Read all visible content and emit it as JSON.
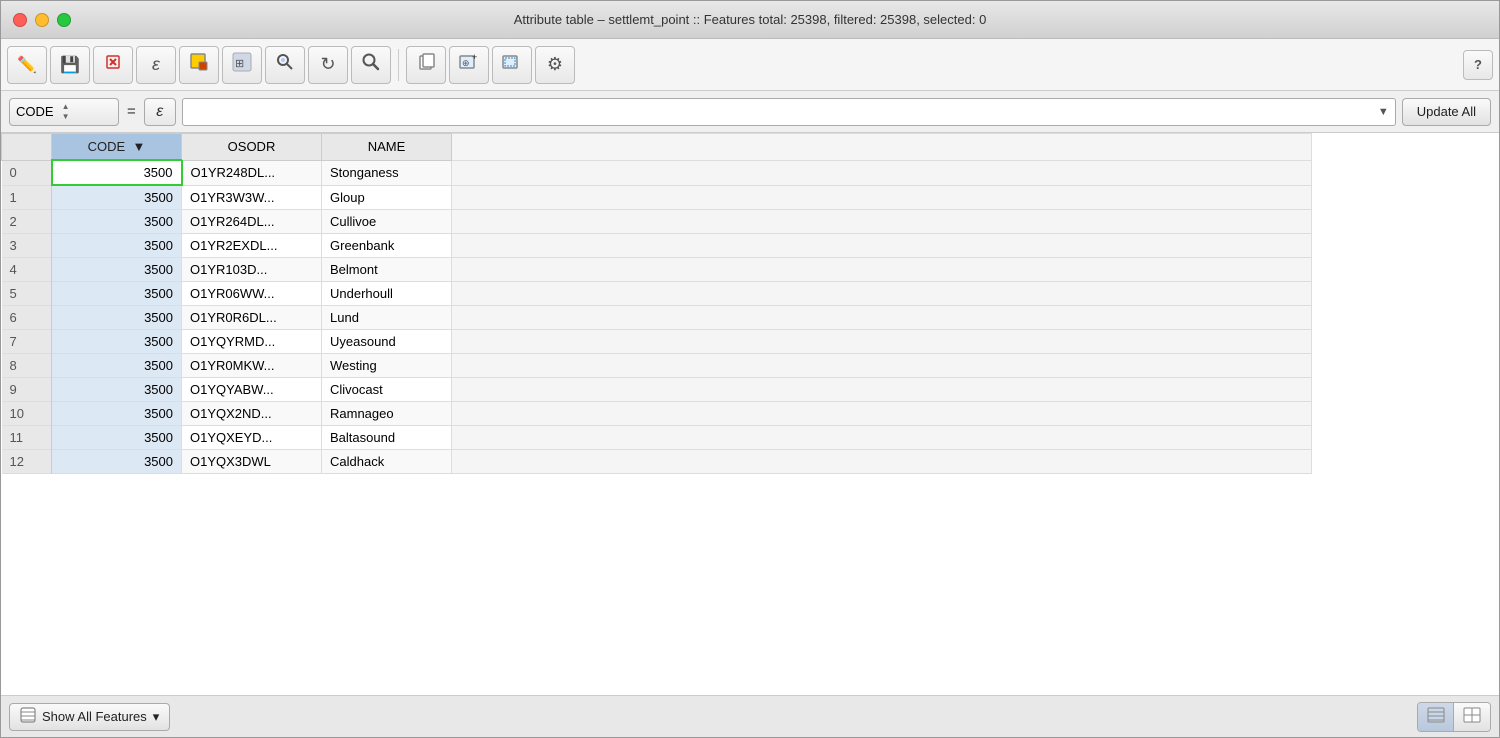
{
  "titlebar": {
    "title": "Attribute table – settlemt_point :: Features total: 25398, filtered: 25398, selected: 0"
  },
  "toolbar": {
    "buttons": [
      {
        "name": "edit-pencil-btn",
        "icon": "✏️",
        "label": "Toggle editing"
      },
      {
        "name": "save-btn",
        "icon": "💾",
        "label": "Save"
      },
      {
        "name": "delete-btn",
        "icon": "✖",
        "label": "Delete selected features",
        "color": "#cc3333"
      },
      {
        "name": "expression-btn",
        "icon": "ε",
        "label": "Expression"
      },
      {
        "name": "select-feat-btn",
        "icon": "⬛",
        "label": "Select features"
      },
      {
        "name": "pan-btn",
        "icon": "⊞",
        "label": "Pan map"
      },
      {
        "name": "refresh-btn",
        "icon": "↻",
        "label": "Reload"
      },
      {
        "name": "find-btn",
        "icon": "🔍",
        "label": "Find"
      },
      {
        "name": "copy-btn",
        "icon": "📋",
        "label": "Copy"
      },
      {
        "name": "zoom-sel-btn",
        "icon": "⊕",
        "label": "Zoom to selection"
      },
      {
        "name": "zoom-layer-btn",
        "icon": "⊞",
        "label": "Zoom to layer"
      },
      {
        "name": "config-btn",
        "icon": "⚙",
        "label": "Configure"
      }
    ],
    "help_label": "?"
  },
  "filterbar": {
    "field_value": "CODE",
    "equals": "=",
    "epsilon_label": "ε",
    "filter_placeholder": "",
    "update_all_label": "Update All"
  },
  "table": {
    "columns": [
      {
        "key": "row_num",
        "label": ""
      },
      {
        "key": "code",
        "label": "CODE"
      },
      {
        "key": "osodr",
        "label": "OSODR"
      },
      {
        "key": "name",
        "label": "NAME"
      }
    ],
    "rows": [
      {
        "row_num": "0",
        "code": "3500",
        "osodr": "O1YR248DL...",
        "name": "Stonganess",
        "first": true
      },
      {
        "row_num": "1",
        "code": "3500",
        "osodr": "O1YR3W3W...",
        "name": "Gloup"
      },
      {
        "row_num": "2",
        "code": "3500",
        "osodr": "O1YR264DL...",
        "name": "Cullivoe"
      },
      {
        "row_num": "3",
        "code": "3500",
        "osodr": "O1YR2EXDL...",
        "name": "Greenbank"
      },
      {
        "row_num": "4",
        "code": "3500",
        "osodr": "O1YR103D...",
        "name": "Belmont"
      },
      {
        "row_num": "5",
        "code": "3500",
        "osodr": "O1YR06WW...",
        "name": "Underhoull"
      },
      {
        "row_num": "6",
        "code": "3500",
        "osodr": "O1YR0R6DL...",
        "name": "Lund"
      },
      {
        "row_num": "7",
        "code": "3500",
        "osodr": "O1YQYRMD...",
        "name": "Uyeasound"
      },
      {
        "row_num": "8",
        "code": "3500",
        "osodr": "O1YR0MKW...",
        "name": "Westing"
      },
      {
        "row_num": "9",
        "code": "3500",
        "osodr": "O1YQYABW...",
        "name": "Clivocast"
      },
      {
        "row_num": "10",
        "code": "3500",
        "osodr": "O1YQX2ND...",
        "name": "Ramnageo"
      },
      {
        "row_num": "11",
        "code": "3500",
        "osodr": "O1YQXEYD...",
        "name": "Baltasound"
      },
      {
        "row_num": "12",
        "code": "3500",
        "osodr": "O1YQX3DWL",
        "name": "Caldhack"
      }
    ]
  },
  "bottombar": {
    "show_all_label": "Show All Features",
    "dropdown_arrow": "▾",
    "view_list_icon": "≡",
    "view_grid_icon": "⊞"
  }
}
